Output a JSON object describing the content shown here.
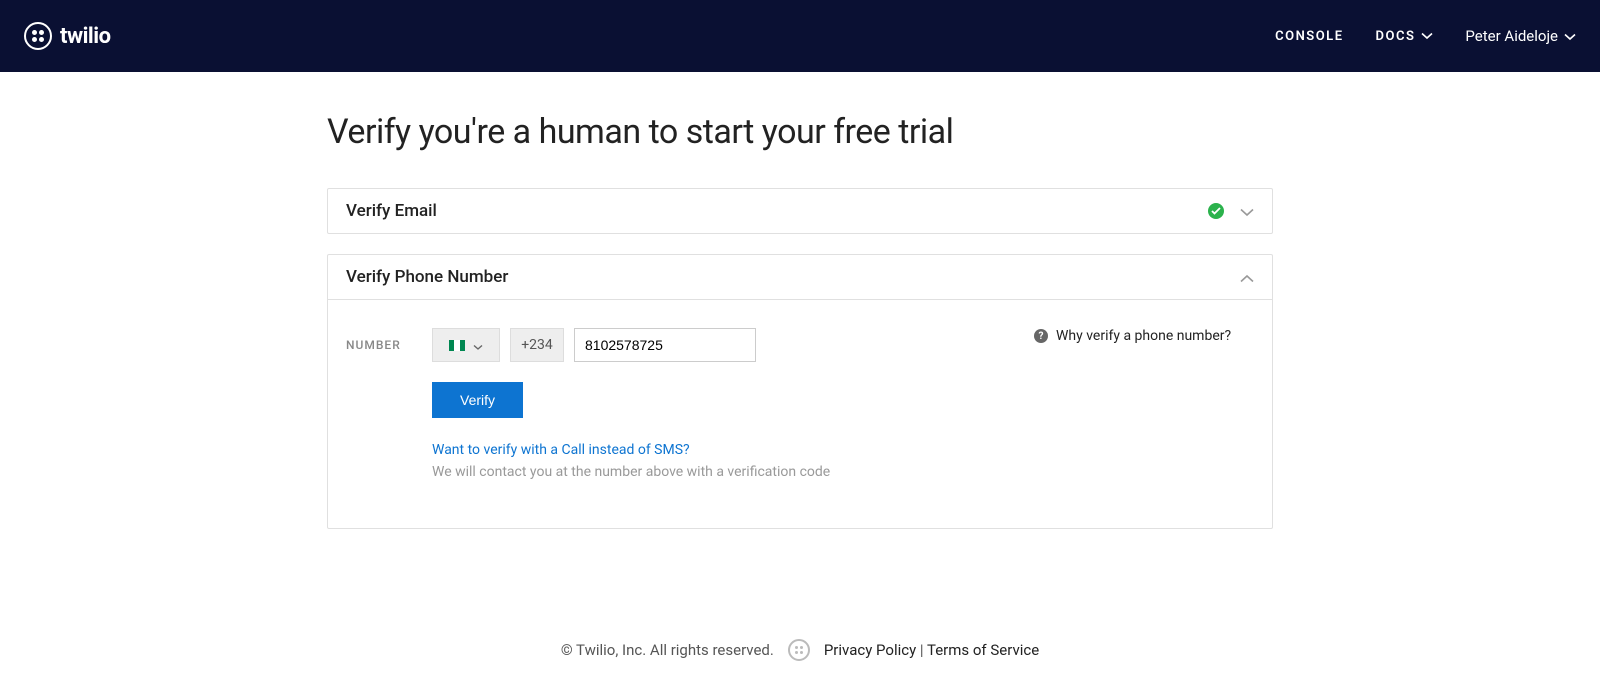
{
  "header": {
    "brand": "twilio",
    "nav": {
      "console": "CONSOLE",
      "docs": "DOCS"
    },
    "user_name": "Peter Aideloje"
  },
  "page": {
    "title": "Verify you're a human to start your free trial"
  },
  "panels": {
    "email": {
      "title": "Verify Email",
      "completed": true
    },
    "phone": {
      "title": "Verify Phone Number",
      "number_label": "NUMBER",
      "country_code": "+234",
      "phone_value": "8102578725",
      "verify_button": "Verify",
      "alt_link": "Want to verify with a Call instead of SMS?",
      "help_text": "We will contact you at the number above with a verification code",
      "info_link": "Why verify a phone number?"
    }
  },
  "footer": {
    "copyright": "© Twilio, Inc. All rights reserved.",
    "privacy": "Privacy Policy",
    "separator": " | ",
    "terms": "Terms of Service"
  }
}
